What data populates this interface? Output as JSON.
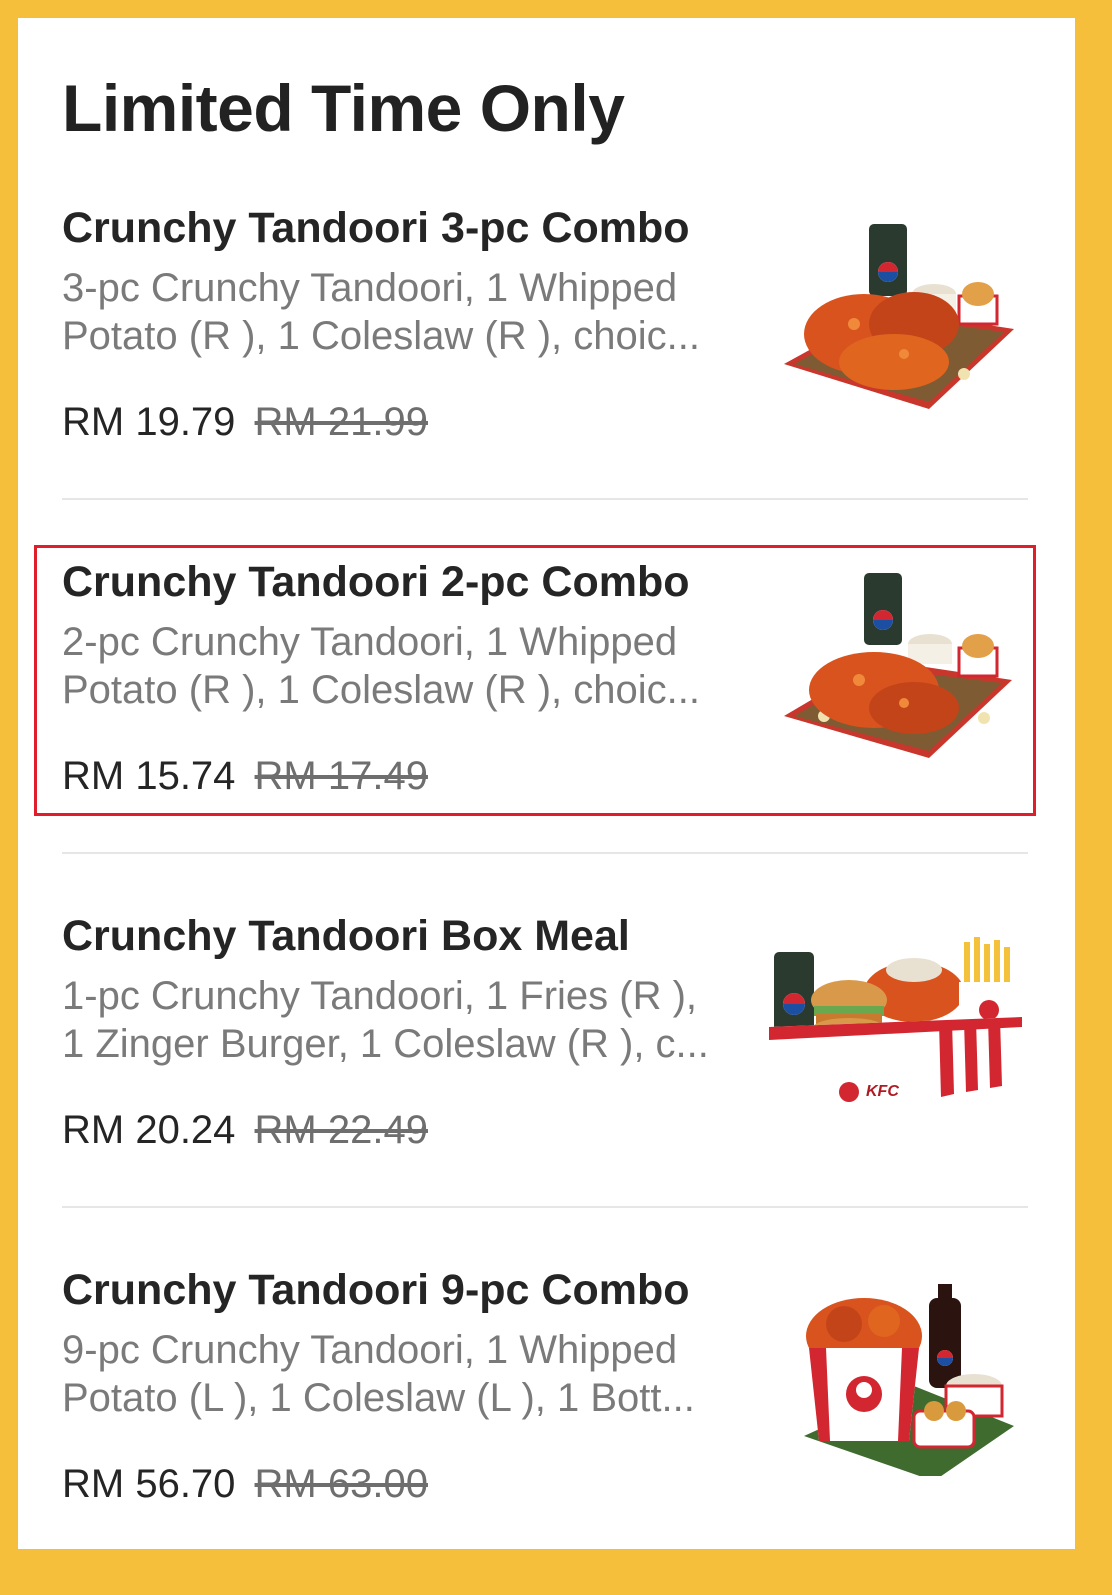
{
  "section": {
    "title": "Limited Time Only"
  },
  "items": [
    {
      "name": "Crunchy Tandoori 3-pc Combo",
      "desc_line1": "3-pc Crunchy Tandoori, 1 Whipped",
      "desc_line2": "Potato (R ), 1 Coleslaw (R ), choic...",
      "price": "RM 19.79",
      "original_price": "RM 21.99",
      "image_icon": "combo-meal-image"
    },
    {
      "name": "Crunchy Tandoori 2-pc Combo",
      "desc_line1": "2-pc Crunchy Tandoori, 1 Whipped",
      "desc_line2": "Potato (R ), 1 Coleslaw (R ), choic...",
      "price": "RM 15.74",
      "original_price": "RM 17.49",
      "image_icon": "combo-meal-image",
      "highlighted": true
    },
    {
      "name": "Crunchy Tandoori Box Meal",
      "desc_line1": "1-pc Crunchy Tandoori, 1 Fries (R ),",
      "desc_line2": "1 Zinger Burger, 1 Coleslaw (R ), c...",
      "price": "RM 20.24",
      "original_price": "RM 22.49",
      "image_icon": "box-meal-image"
    },
    {
      "name": "Crunchy Tandoori 9-pc Combo",
      "desc_line1": "9-pc Crunchy Tandoori, 1 Whipped",
      "desc_line2": "Potato (L ), 1 Coleslaw (L ), 1 Bott...",
      "price": "RM 56.70",
      "original_price": "RM 63.00",
      "image_icon": "bucket-meal-image"
    }
  ],
  "colors": {
    "frame": "#f6bf3b",
    "highlight": "#e01e2b",
    "drink_can": "#2b3a2f",
    "chicken": "#d9531e"
  }
}
